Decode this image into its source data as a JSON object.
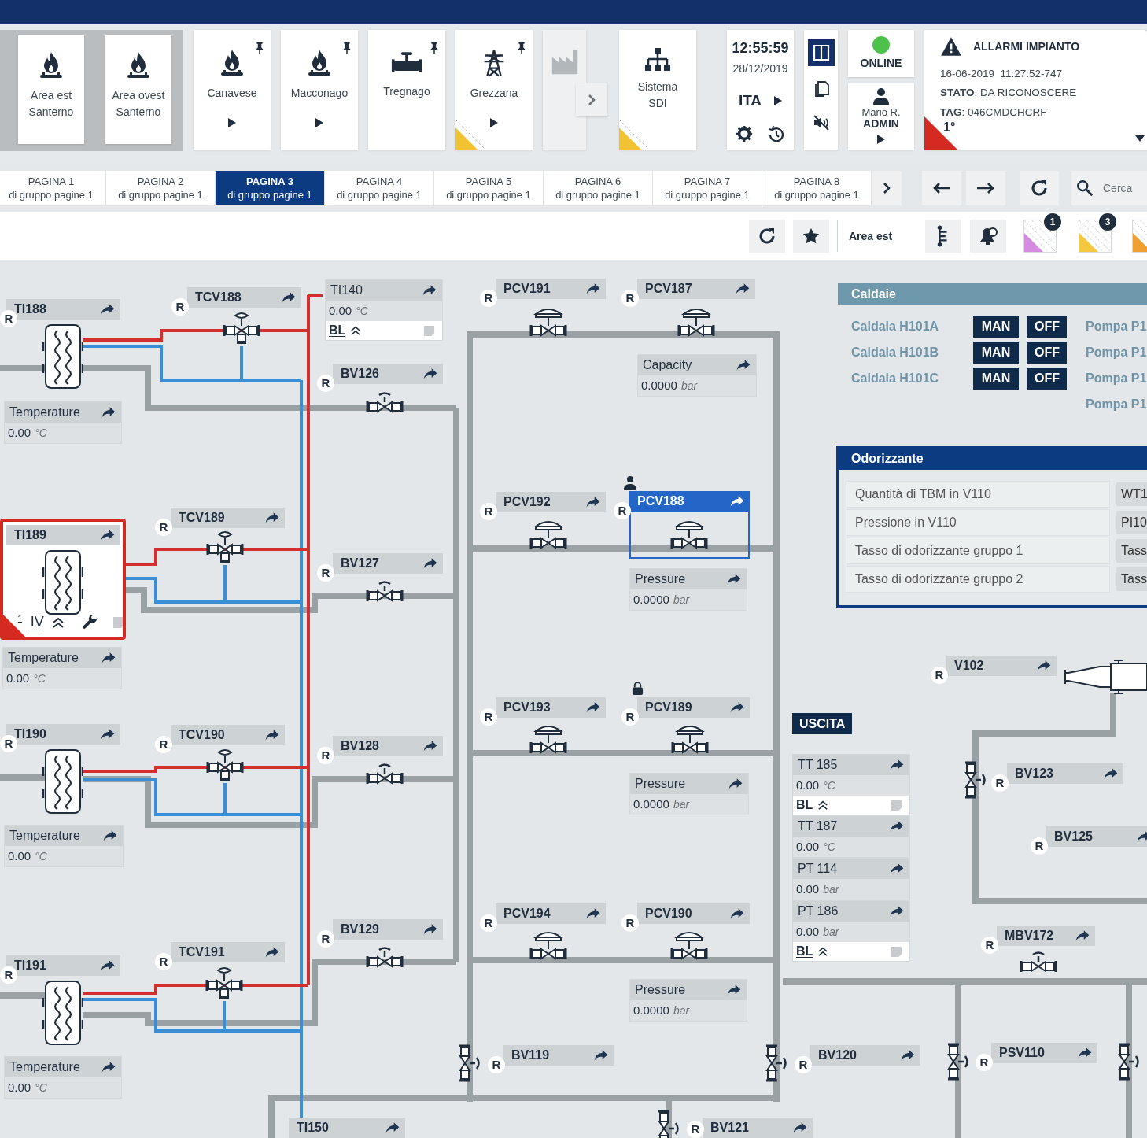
{
  "header": {
    "site_group": [
      {
        "label": "Area est\nSanterno",
        "kind": "burner"
      },
      {
        "label": "Area ovest\nSanterno",
        "kind": "burner"
      }
    ],
    "sites": [
      {
        "label": "Canavese",
        "kind": "burner",
        "pinned": true,
        "expandable": true,
        "flagged": false,
        "disabled": false
      },
      {
        "label": "Macconago",
        "kind": "burner",
        "pinned": true,
        "expandable": true,
        "flagged": false,
        "disabled": false
      },
      {
        "label": "Tregnago",
        "kind": "valve",
        "pinned": true,
        "expandable": false,
        "flagged": false,
        "disabled": false
      },
      {
        "label": "Grezzana",
        "kind": "pylon",
        "pinned": true,
        "expandable": true,
        "flagged": true,
        "disabled": false
      },
      {
        "kind": "factory",
        "pinned": false,
        "expandable": false,
        "flagged": false,
        "disabled": true
      },
      {
        "label": "Sistema\nSDI",
        "kind": "network",
        "pinned": false,
        "expandable": false,
        "flagged": true,
        "disabled": false
      }
    ],
    "clock": {
      "time": "12:55:59",
      "date": "28/12/2019",
      "language": "ITA"
    },
    "views": [
      {
        "kind": "split",
        "selected": true
      },
      {
        "kind": "pages",
        "selected": false
      }
    ],
    "muted": true,
    "connection": {
      "label": "ONLINE",
      "online": true
    },
    "user": {
      "name": "Mario R.",
      "role": "ADMIN"
    },
    "alarm": {
      "title": "ALLARMI IMPIANTO",
      "timestamp": "16-06-2019  11:27:52-747",
      "status": "**STATO**: DA RICONOSCERE",
      "tag": "**TAG**: 046CMDCHCRF",
      "priority": "1°"
    }
  },
  "tabs": [
    {
      "title": "PAGINA 1",
      "subtitle": "di gruppo pagine 1",
      "selected": false
    },
    {
      "title": "PAGINA 2",
      "subtitle": "di gruppo pagine 1",
      "selected": false
    },
    {
      "title": "PAGINA 3",
      "subtitle": "di gruppo pagine 1",
      "selected": true
    },
    {
      "title": "PAGINA 4",
      "subtitle": "di gruppo pagine 1",
      "selected": false
    },
    {
      "title": "PAGINA 5",
      "subtitle": "di gruppo pagine 1",
      "selected": false
    },
    {
      "title": "PAGINA 6",
      "subtitle": "di gruppo pagine 1",
      "selected": false
    },
    {
      "title": "PAGINA 7",
      "subtitle": "di gruppo pagine 1",
      "selected": false
    },
    {
      "title": "PAGINA 8",
      "subtitle": "di gruppo pagine 1",
      "selected": false
    }
  ],
  "search": {
    "placeholder": "Cerca"
  },
  "toolbar": {
    "area": "Area est",
    "alarm_filters": [
      {
        "count": "1",
        "color": "#d58be0"
      },
      {
        "count": "3",
        "color": "#f5c842"
      },
      {
        "color": "#f0a030"
      }
    ]
  },
  "diagram": {
    "exchangers": [
      {
        "tag": "TI188",
        "marker": "R",
        "alarm": false
      },
      {
        "tag": "TI189",
        "alarm": true,
        "priority": "1",
        "level": "IV"
      },
      {
        "tag": "TI190",
        "marker": "R",
        "alarm": false
      },
      {
        "tag": "TI191",
        "marker": "R",
        "alarm": false
      }
    ],
    "tags": [
      {
        "label": "TCV188",
        "marker": "R",
        "selected": false
      },
      {
        "label": "BV126",
        "marker": "R",
        "selected": false
      },
      {
        "label": "PCV191",
        "marker": "R",
        "selected": false
      },
      {
        "label": "PCV187",
        "marker": "R",
        "selected": false
      },
      {
        "label": "TCV189",
        "marker": "R",
        "selected": false
      },
      {
        "label": "BV127",
        "marker": "R",
        "selected": false
      },
      {
        "label": "PCV192",
        "marker": "R",
        "selected": false
      },
      {
        "label": "PCV188",
        "marker": "R",
        "selected": true,
        "kind": "user"
      },
      {
        "label": "TCV190",
        "marker": "R",
        "selected": false
      },
      {
        "label": "BV128",
        "marker": "R",
        "selected": false
      },
      {
        "label": "PCV193",
        "marker": "R",
        "selected": false
      },
      {
        "label": "PCV189",
        "marker": "R",
        "selected": false,
        "kind": "lock"
      },
      {
        "label": "V102",
        "marker": "R",
        "selected": false
      },
      {
        "label": "BV123",
        "marker": "R",
        "selected": false
      },
      {
        "label": "BV125",
        "marker": "R",
        "selected": false
      },
      {
        "label": "MBV172",
        "marker": "R",
        "selected": false
      },
      {
        "label": "TCV191",
        "marker": "R",
        "selected": false
      },
      {
        "label": "BV129",
        "marker": "R",
        "selected": false
      },
      {
        "label": "PCV194",
        "marker": "R",
        "selected": false
      },
      {
        "label": "PCV190",
        "marker": "R",
        "selected": false
      },
      {
        "label": "BV119",
        "marker": "R",
        "selected": false
      },
      {
        "label": "BV120",
        "marker": "R",
        "selected": false
      },
      {
        "label": "PSV110",
        "marker": "R",
        "selected": false
      },
      {
        "label": "TI150",
        "selected": false
      },
      {
        "label": "BV121",
        "marker": "R",
        "selected": false
      }
    ],
    "readings": [
      {
        "label": "TI140",
        "value": "0.00",
        "unit": "°C",
        "block": "BL"
      },
      {
        "label": "Temperature",
        "value": "0.00",
        "unit": "°C"
      },
      {
        "label": "Capacity",
        "value": "0.0000",
        "unit": "bar"
      },
      {
        "label": "Temperature",
        "value": "0.00",
        "unit": "°C"
      },
      {
        "label": "Pressure",
        "value": "0.0000",
        "unit": "bar"
      },
      {
        "label": "Pressure",
        "value": "0.0000",
        "unit": "bar"
      },
      {
        "label": "Temperature",
        "value": "0.00",
        "unit": "°C"
      },
      {
        "label": "Pressure",
        "value": "0.0000",
        "unit": "bar"
      },
      {
        "label": "Temperature",
        "value": "0.00",
        "unit": "°C"
      }
    ],
    "caldaie": {
      "title": "Caldaie",
      "boilers": [
        {
          "name": "Caldaia H101A",
          "mode": "MAN",
          "state": "OFF"
        },
        {
          "name": "Caldaia H101B",
          "mode": "MAN",
          "state": "OFF"
        },
        {
          "name": "Caldaia H101C",
          "mode": "MAN",
          "state": "OFF"
        }
      ],
      "pumps": [
        "Pompa P1",
        "Pompa P1",
        "Pompa P1",
        "Pompa P1"
      ]
    },
    "odorizzante": {
      "title": "Odorizzante",
      "rows": [
        {
          "label": "Quantità di TBM in V110",
          "code": "WT1"
        },
        {
          "label": "Pressione in V110",
          "code": "PI10"
        },
        {
          "label": "Tasso di odorizzante gruppo 1",
          "code": "Tass"
        },
        {
          "label": "Tasso di odorizzante gruppo 2",
          "code": "Tass"
        }
      ]
    },
    "uscita": {
      "title": "USCITA",
      "readings": [
        {
          "label": "TT 185",
          "value": "0.00",
          "unit": "°C",
          "block": "BL"
        },
        {
          "label": "TT 187",
          "value": "0.00",
          "unit": "°C"
        },
        {
          "label": "PT 114",
          "value": "0.00",
          "unit": "bar"
        },
        {
          "label": "PT 186",
          "value": "0.00",
          "unit": "bar",
          "block": "BL"
        }
      ]
    }
  }
}
